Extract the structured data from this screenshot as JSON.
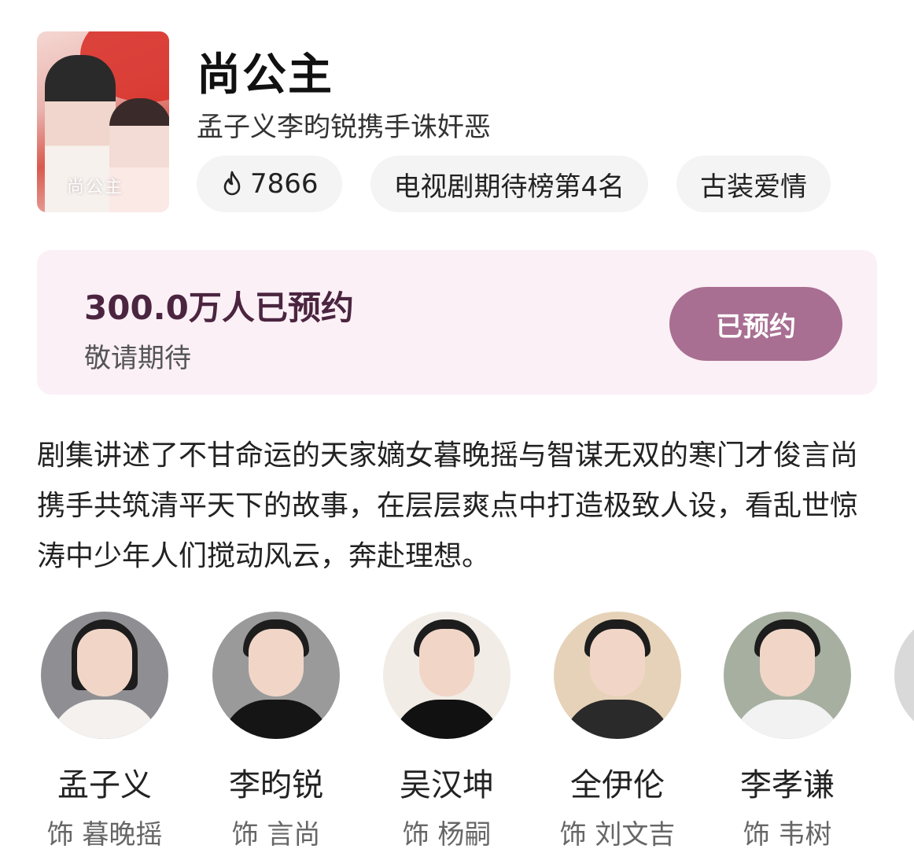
{
  "show": {
    "title": "尚公主",
    "subtitle": "孟子义李昀锐携手诛奸恶",
    "poster_text": "尚公主"
  },
  "tags": {
    "heat": "7866",
    "rank": "电视剧期待榜第4名",
    "genre": "古装爱情"
  },
  "reservation": {
    "count": "300.0万人已预约",
    "hint": "敬请期待",
    "button": "已预约"
  },
  "description": "剧集讲述了不甘命运的天家嫡女暮晚摇与智谋无双的寒门才俊言尚携手共筑清平天下的故事，在层层爽点中打造极致人设，看乱世惊涛中少年人们搅动风云，奔赴理想。",
  "cast": [
    {
      "name": "孟子义",
      "role": "饰 暮晚摇"
    },
    {
      "name": "李昀锐",
      "role": "饰 言尚"
    },
    {
      "name": "吴汉坤",
      "role": "饰 杨嗣"
    },
    {
      "name": "全伊伦",
      "role": "饰 刘文吉"
    },
    {
      "name": "李孝谦",
      "role": "饰 韦树"
    }
  ],
  "colors": {
    "reserve_bg": "#fbf0f6",
    "button": "#a86f92",
    "count_text": "#4b2540",
    "tag_bg": "#f4f4f5"
  },
  "icons": {
    "heat": "flame-icon"
  }
}
